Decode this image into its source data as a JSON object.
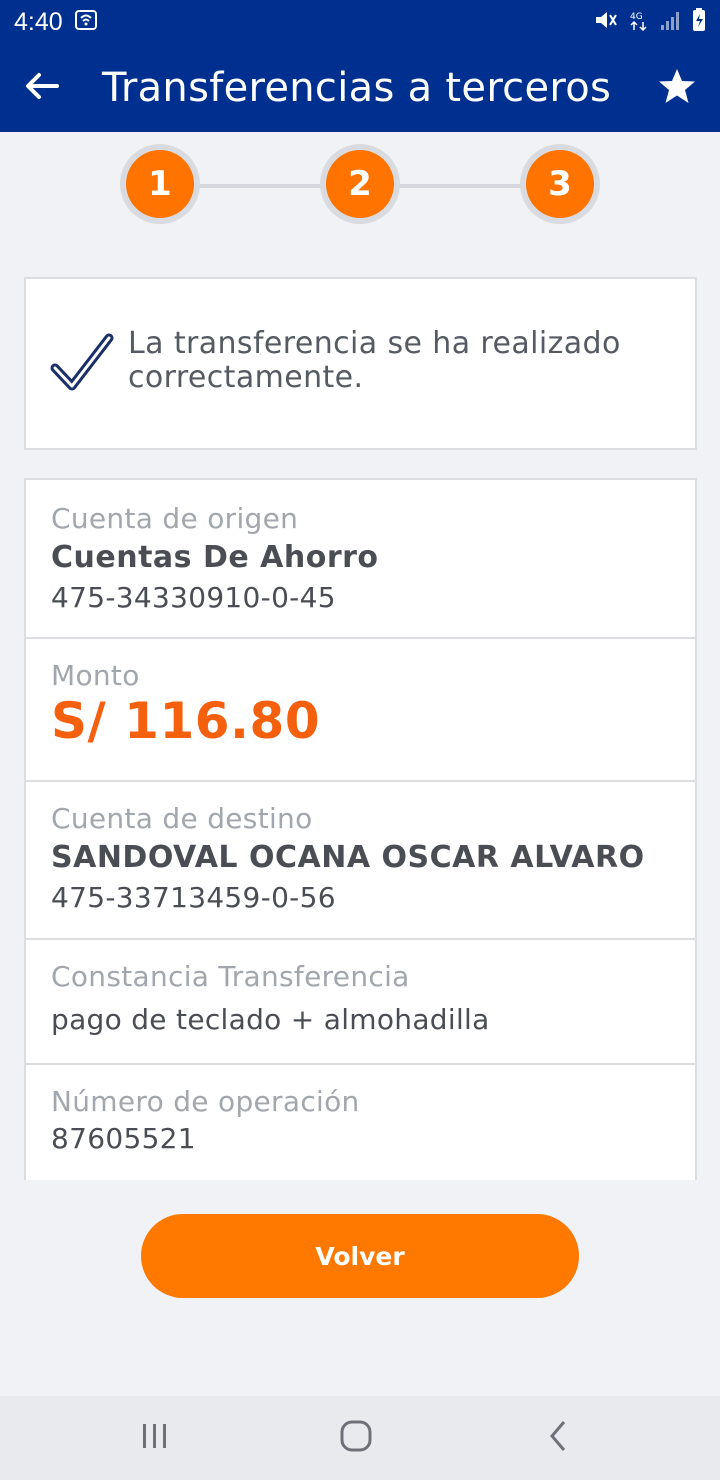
{
  "status_bar": {
    "time": "4:40"
  },
  "header": {
    "title": "Transferencias a terceros"
  },
  "stepper": {
    "steps": [
      "1",
      "2",
      "3"
    ]
  },
  "success": {
    "message": "La transferencia se ha realizado correctamente."
  },
  "details": {
    "origin": {
      "label": "Cuenta de origen",
      "account_type": "Cuentas De Ahorro",
      "account_number": "475-34330910-0-45"
    },
    "amount": {
      "label": "Monto",
      "value": "S/ 116.80"
    },
    "destination": {
      "label": "Cuenta de destino",
      "name": "SANDOVAL OCANA OSCAR ALVARO",
      "account_number": "475-33713459-0-56"
    },
    "receipt": {
      "label": "Constancia Transferencia",
      "value": "pago de teclado + almohadilla"
    },
    "operation": {
      "label": "Número de operación",
      "value": "87605521"
    }
  },
  "actions": {
    "back_label": "Volver"
  },
  "colors": {
    "primary": "#00308f",
    "accent": "#ff7800",
    "amount": "#f5600f"
  }
}
